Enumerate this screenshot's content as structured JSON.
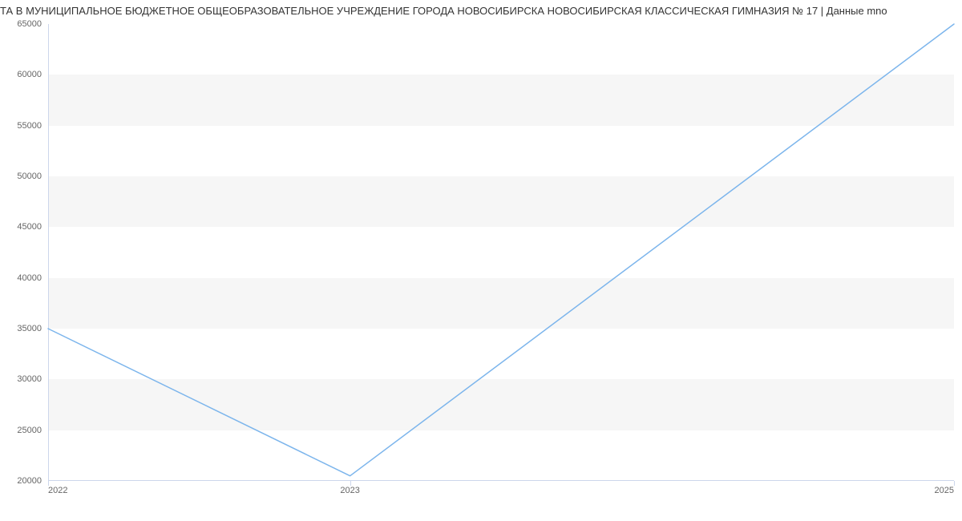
{
  "chart_data": {
    "type": "line",
    "title": "ТА В МУНИЦИПАЛЬНОЕ БЮДЖЕТНОЕ ОБЩЕОБРАЗОВАТЕЛЬНОЕ УЧРЕЖДЕНИЕ ГОРОДА НОВОСИБИРСКА НОВОСИБИРСКАЯ КЛАССИЧЕСКАЯ ГИМНАЗИЯ № 17 | Данные mno",
    "x": [
      2022,
      2023,
      2025
    ],
    "values": [
      35000,
      20500,
      65000
    ],
    "xlabel": "",
    "ylabel": "",
    "ylim": [
      20000,
      65000
    ],
    "y_ticks": [
      20000,
      25000,
      30000,
      35000,
      40000,
      45000,
      50000,
      55000,
      60000,
      65000
    ],
    "x_ticks": [
      2022,
      2023,
      2025
    ],
    "series_color": "#7cb5ec"
  }
}
